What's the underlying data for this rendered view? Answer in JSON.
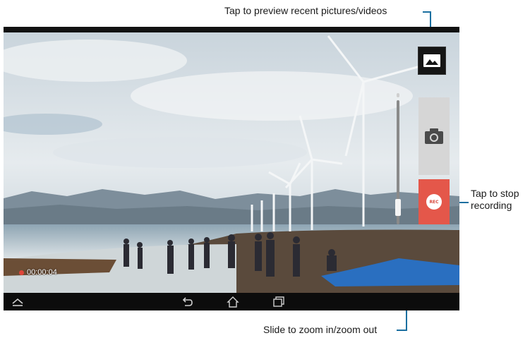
{
  "callouts": {
    "preview": "Tap to preview recent pictures/videos",
    "stop_line1": "Tap to stop",
    "stop_line2": "recording",
    "zoom": "Slide to zoom in/zoom out"
  },
  "camera": {
    "recording_time": "00:00:04",
    "rec_label": "REC",
    "icons": [
      "gallery-thumbnail-icon",
      "camera-icon",
      "record-stop-icon",
      "recording-indicator-icon"
    ],
    "zoom_level": 0.08
  },
  "navbar": {
    "icons": [
      "navigation-toggle-icon",
      "back-icon",
      "home-icon",
      "recent-apps-icon"
    ]
  },
  "colors": {
    "callout_line": "#1a6fa0",
    "rec_button": "#e4574a",
    "photo_button": "#d6d6d6"
  }
}
